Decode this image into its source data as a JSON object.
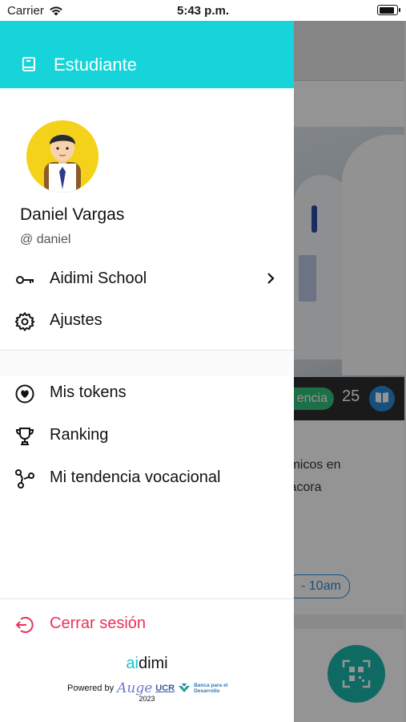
{
  "status_bar": {
    "carrier": "Carrier",
    "time": "5:43 p.m."
  },
  "drawer": {
    "header_title": "Estudiante",
    "user": {
      "name": "Daniel Vargas",
      "handle": "@ daniel"
    },
    "menu": [
      {
        "label": "Aidimi School",
        "icon": "key-icon",
        "has_chevron": true
      },
      {
        "label": "Ajustes",
        "icon": "gear-icon"
      },
      {
        "label": "Mis tokens",
        "icon": "heart-circle-icon"
      },
      {
        "label": "Ranking",
        "icon": "trophy-icon"
      },
      {
        "label": "Mi tendencia vocacional",
        "icon": "graph-nodes-icon"
      }
    ],
    "logout_label": "Cerrar sesión",
    "footer": {
      "logo_ai": "ai",
      "logo_rest": "dimi",
      "powered_by": "Powered by",
      "partner_auge": "Auge",
      "partner_ucr": "UCR",
      "partner_banco_line1": "Banca para el",
      "partner_banco_line2": "Desarrollo",
      "year": "2023"
    }
  },
  "background_app": {
    "pill_text": "encia",
    "count": "25",
    "text_line1": "ímicos en",
    "text_line2": "tácora",
    "time_pill": "- 10am"
  },
  "colors": {
    "accent": "#16d4d9",
    "logout": "#e8325e",
    "avatar_bg": "#f5d21a"
  }
}
